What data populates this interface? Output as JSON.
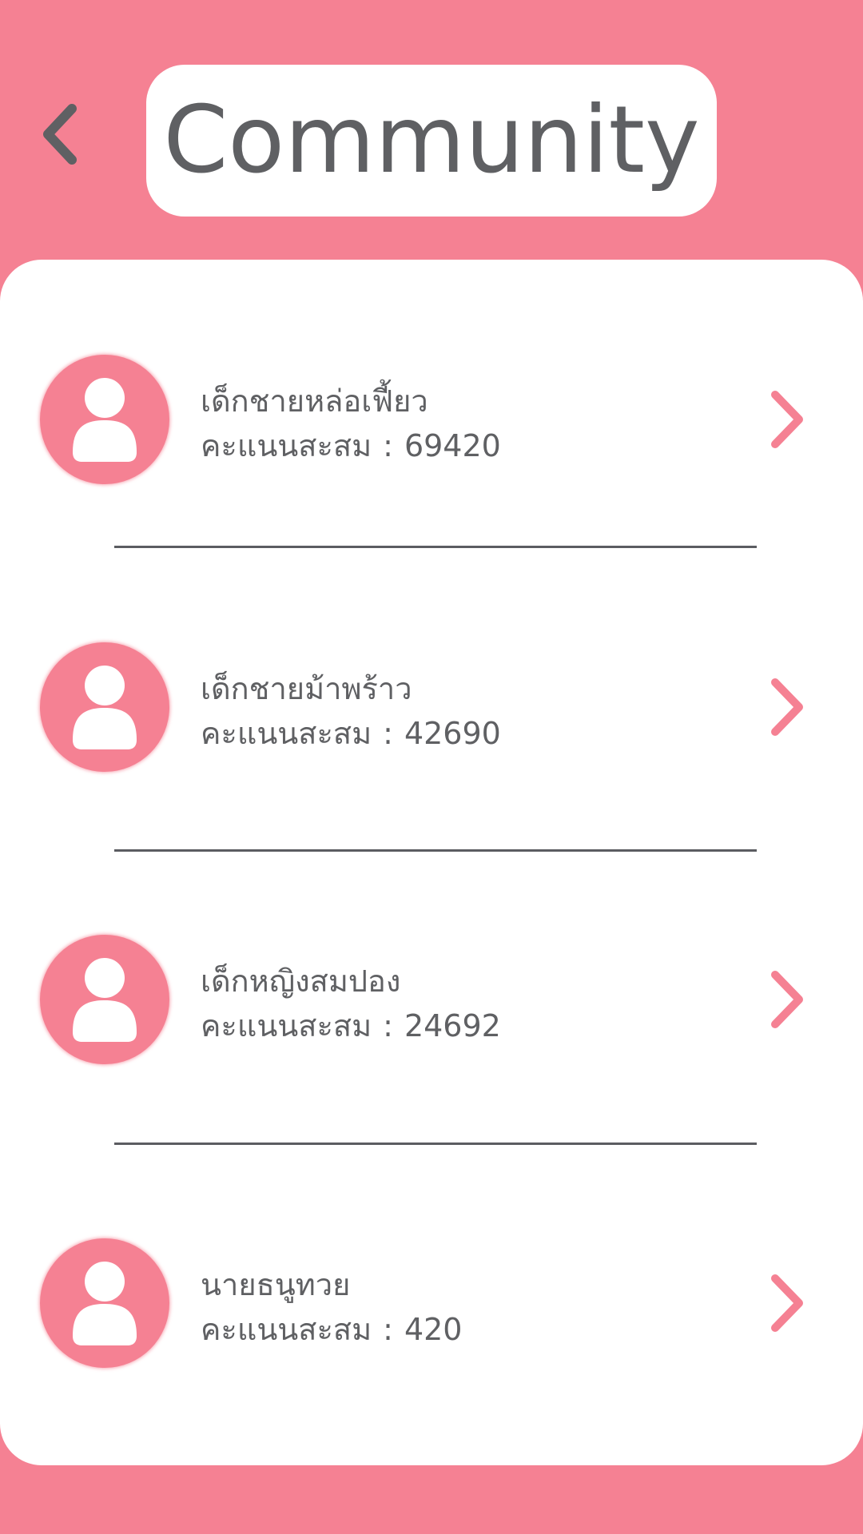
{
  "header": {
    "title": "Community",
    "back_icon": "chevron-left-icon"
  },
  "colors": {
    "background": "#f58193",
    "card": "#ffffff",
    "text": "#5f6063",
    "accent": "#f58193",
    "divider": "#5b5c61"
  },
  "members": [
    {
      "name": "เด็กชายหล่อเฟี้ยว",
      "score_label": "คะแนนสะสม",
      "separator": ":",
      "score": "69420",
      "avatar_icon": "user-avatar-icon",
      "action_icon": "chevron-right-icon"
    },
    {
      "name": "เด็กชายม้าพร้าว",
      "score_label": "คะแนนสะสม",
      "separator": ":",
      "score": "42690",
      "avatar_icon": "user-avatar-icon",
      "action_icon": "chevron-right-icon"
    },
    {
      "name": "เด็กหญิงสมปอง",
      "score_label": "คะแนนสะสม",
      "separator": ":",
      "score": "24692",
      "avatar_icon": "user-avatar-icon",
      "action_icon": "chevron-right-icon"
    },
    {
      "name": "นายธนูทวย",
      "score_label": "คะแนนสะสม",
      "separator": ":",
      "score": "420",
      "avatar_icon": "user-avatar-icon",
      "action_icon": "chevron-right-icon"
    }
  ]
}
